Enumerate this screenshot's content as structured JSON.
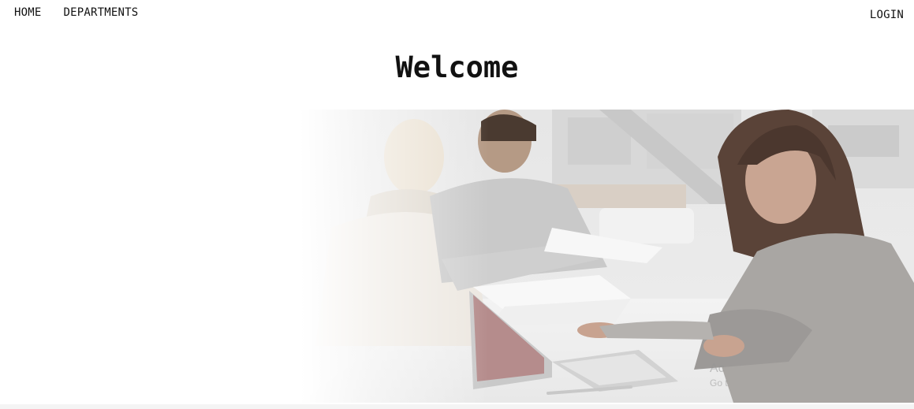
{
  "nav": {
    "home_label": "HOME",
    "departments_label": "DEPARTMENTS",
    "login_label": "LOGIN"
  },
  "hero": {
    "title": "Welcome",
    "image_subject": "students-studying-with-laptop"
  },
  "watermark": {
    "line1": "Ac",
    "line2": "Go t"
  },
  "colors": {
    "text": "#111111",
    "background": "#ffffff"
  }
}
